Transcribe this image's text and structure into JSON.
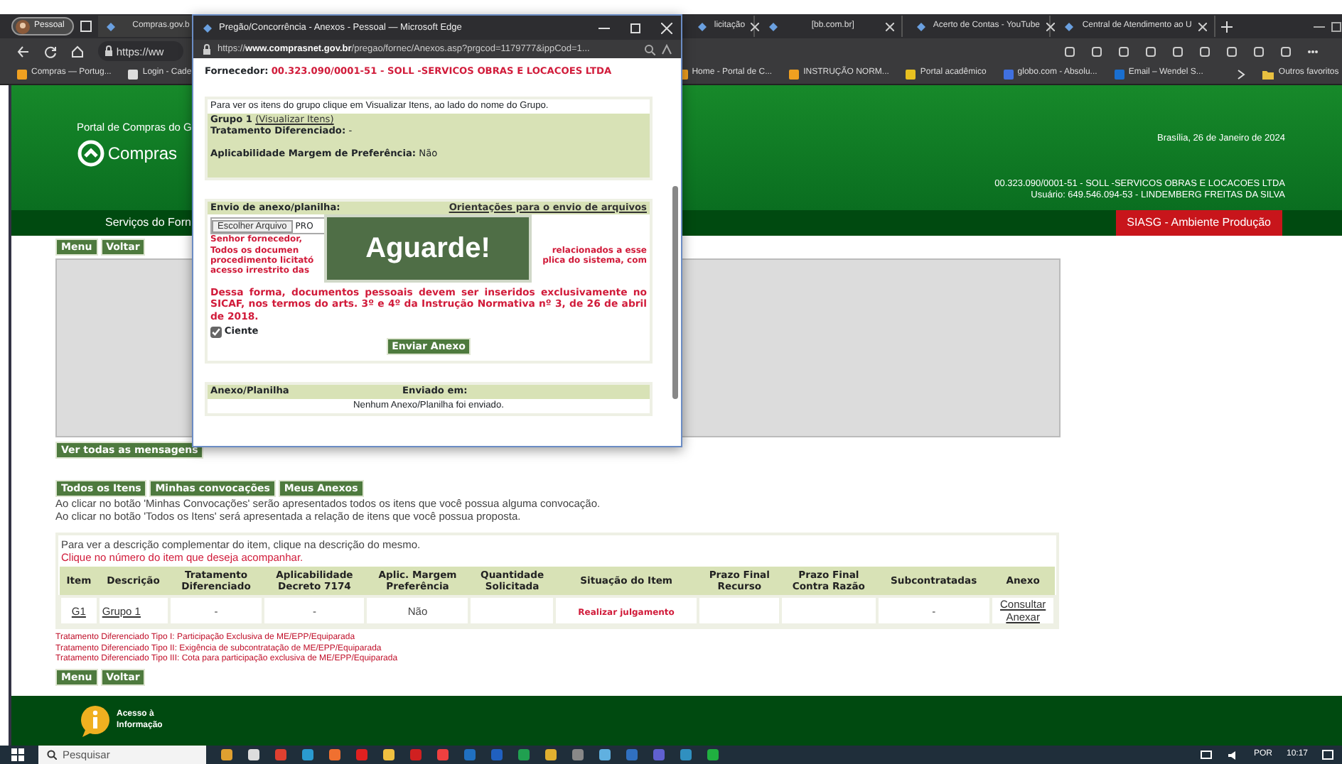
{
  "browser": {
    "profile": "Pessoal",
    "tabs": [
      {
        "title": "Compras.gov.b",
        "selected": true
      },
      {
        "title": "licitação",
        "selected": false
      },
      {
        "title": "[bb.com.br]",
        "selected": false
      },
      {
        "title": "Acerto de Contas - YouTube",
        "selected": false
      },
      {
        "title": "Central de Atendimento ao U",
        "selected": false
      }
    ],
    "address": "https://ww",
    "bookmarks": [
      "Compras — Portug...",
      "Login - Cade",
      "Home - Portal de C...",
      "INSTRUÇÃO NORM...",
      "Portal acadêmico",
      "globo.com - Absolu...",
      "Email – Wendel S..."
    ],
    "more_bookmarks": "Outros favoritos"
  },
  "page": {
    "portal_title": "Portal de Compras do G",
    "logo_text": "Compras",
    "date": "Brasília, 26 de Janeiro de 2024",
    "company": "00.323.090/0001-51 - SOLL -SERVICOS OBRAS E LOCACOES LTDA",
    "user": "Usuário: 649.546.094-53 - LINDEMBERG FREITAS DA SILVA",
    "nav_label": "Serviços do Forn",
    "environment": "SIASG - Ambiente Produção",
    "top_buttons": [
      "Menu",
      "Voltar"
    ],
    "messages_button": "Ver todas as mensagens",
    "filter_buttons": [
      "Todos os Itens",
      "Minhas convocações",
      "Meus Anexos"
    ],
    "help_lines": [
      "Ao clicar no botão 'Minhas Convocações' serão apresentados todos os itens que você possua alguma convocação.",
      "Ao clicar no botão 'Todos os Itens' será apresentada a relação de itens que você possua proposta."
    ],
    "table": {
      "intro": "Para ver a descrição complementar do item, clique na descrição do mesmo.",
      "hint": "Clique no número do item que deseja acompanhar.",
      "columns": [
        "Item",
        "Descrição",
        "Tratamento Diferenciado",
        "Aplicabilidade Decreto 7174",
        "Aplic. Margem Preferência",
        "Quantidade Solicitada",
        "Situação do Item",
        "Prazo Final Recurso",
        "Prazo Final Contra Razão",
        "Subcontratadas",
        "Anexo"
      ],
      "rows": [
        [
          {
            "kind": "link",
            "text": "G1"
          },
          {
            "kind": "link",
            "text": "Grupo 1"
          },
          {
            "kind": "dash",
            "text": "-"
          },
          {
            "kind": "dash",
            "text": "-"
          },
          {
            "kind": "plain",
            "text": "Não"
          },
          null,
          {
            "kind": "status",
            "text": "Realizar julgamento"
          },
          null,
          null,
          {
            "kind": "dash",
            "text": "-"
          },
          {
            "kind": "links",
            "links": [
              "Consultar",
              "Anexar"
            ]
          }
        ]
      ]
    },
    "footnotes": [
      "Tratamento Diferenciado Tipo I: Participação Exclusiva de ME/EPP/Equiparada",
      "Tratamento Diferenciado Tipo II: Exigência de subcontratação de ME/EPP/Equiparada",
      "Tratamento Diferenciado Tipo III: Cota para participação exclusiva de ME/EPP/Equiparada"
    ],
    "bottom_buttons": [
      "Menu",
      "Voltar"
    ],
    "footer_link": "Acesso à Informação"
  },
  "popup": {
    "title": "Pregão/Concorrência - Anexos - Pessoal — Microsoft Edge",
    "url_prefix": "https://",
    "url_host": "www.comprasnet.gov.br",
    "url_path": "/pregao/fornec/Anexos.asp?prgcod=1179777&ippCod=1...",
    "supplier_label": "Fornecedor:",
    "supplier_value": "00.323.090/0001-51 - SOLL -SERVICOS OBRAS E LOCACOES LTDA",
    "group_hint": "Para ver os itens do grupo clique em Visualizar Itens, ao lado do nome do Grupo.",
    "group_name": "Grupo 1",
    "group_link": "(Visualizar Itens)",
    "fields": [
      "**Tratamento Diferenciado:** -",
      "**Aplicabilidade Margem de Preferência:** Não"
    ],
    "upload_title": "Envio de anexo/planilha:",
    "upload_guide": "Orientações para o envio de arquivos",
    "file_button": "Escolher Arquivo",
    "file_name": "PRO",
    "notice_greeting": "Senhor fornecedor,",
    "notice_left": [
      "Todos os documen",
      "procedimento licitató",
      "acesso irrestrito das"
    ],
    "notice_right": [
      "relacionados a esse",
      "plica do sistema, com"
    ],
    "notice2": "Dessa forma, documentos pessoais devem ser inseridos exclusivamente no SICAF, nos termos do arts. 3º e 4º da Instrução Normativa nº 3, de 26 de abril de 2018.",
    "ciente": {
      "label": "Ciente",
      "checked": true
    },
    "send_button": "Enviar Anexo",
    "attachments": {
      "columns": [
        "Anexo/Planilha",
        "Enviado em:"
      ],
      "empty": "Nenhum Anexo/Planilha foi enviado."
    },
    "overlay": "Aguarde!"
  },
  "taskbar": {
    "search": "Pesquisar",
    "language": "POR",
    "time": "10:17"
  }
}
